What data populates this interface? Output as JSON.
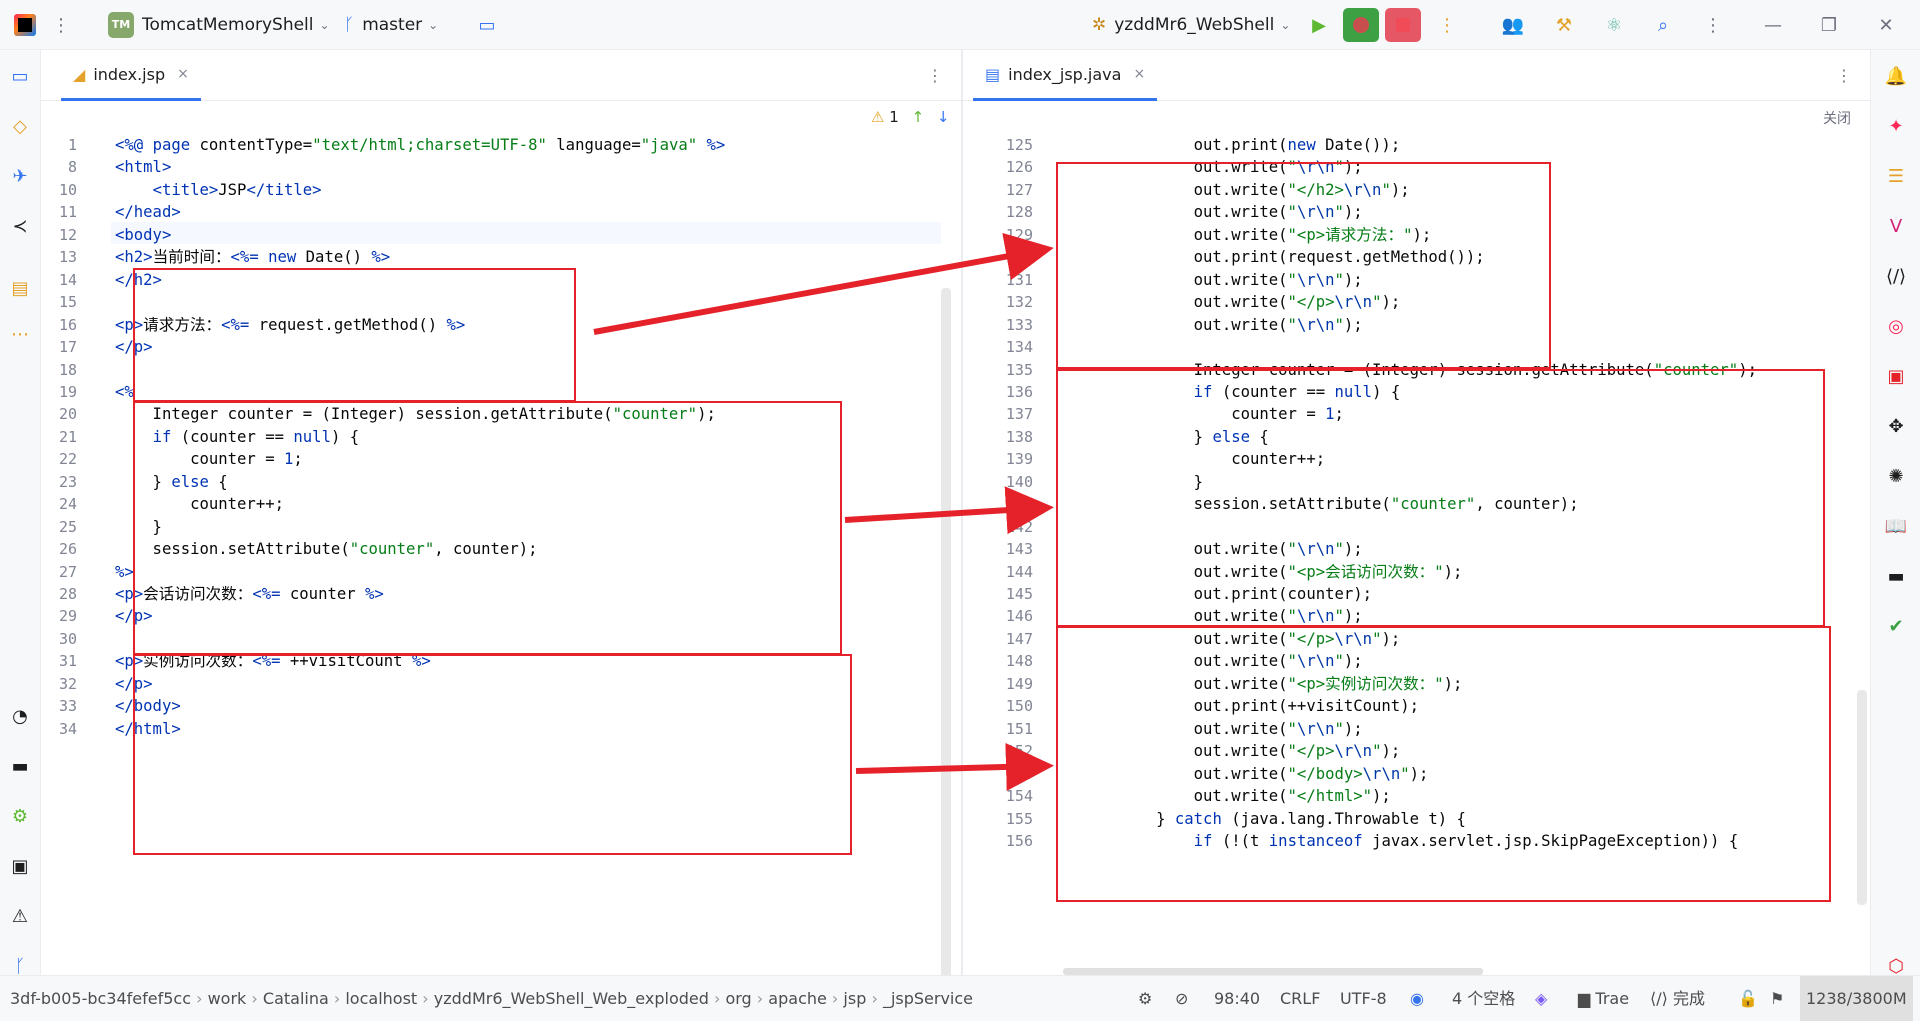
{
  "titlebar": {
    "project_badge": "TM",
    "project_name": "TomcatMemoryShell",
    "branch": "master",
    "run_config": "yzddMr6_WebShell"
  },
  "left_editor": {
    "tab_label": "index.jsp",
    "tab_close": "×",
    "warning_count": "1",
    "lines": [
      {
        "n": "1",
        "text": "<%@ page contentType=\"text/html;charset=UTF-8\" language=\"java\" %>"
      },
      {
        "n": "8",
        "text": "<html>"
      },
      {
        "n": "10",
        "text": "    <title>JSP</title>"
      },
      {
        "n": "11",
        "text": "</head>"
      },
      {
        "n": "12",
        "text": "<body>"
      },
      {
        "n": "13",
        "text": "<h2>当前时间：<%= new Date() %>"
      },
      {
        "n": "14",
        "text": "</h2>"
      },
      {
        "n": "15",
        "text": ""
      },
      {
        "n": "16",
        "text": "<p>请求方法：<%= request.getMethod() %>"
      },
      {
        "n": "17",
        "text": "</p>"
      },
      {
        "n": "18",
        "text": ""
      },
      {
        "n": "19",
        "text": "<%"
      },
      {
        "n": "20",
        "text": "    Integer counter = (Integer) session.getAttribute(\"counter\");"
      },
      {
        "n": "21",
        "text": "    if (counter == null) {"
      },
      {
        "n": "22",
        "text": "        counter = 1;"
      },
      {
        "n": "23",
        "text": "    } else {"
      },
      {
        "n": "24",
        "text": "        counter++;"
      },
      {
        "n": "25",
        "text": "    }"
      },
      {
        "n": "26",
        "text": "    session.setAttribute(\"counter\", counter);"
      },
      {
        "n": "27",
        "text": "%>"
      },
      {
        "n": "28",
        "text": "<p>会话访问次数：<%= counter %>"
      },
      {
        "n": "29",
        "text": "</p>"
      },
      {
        "n": "30",
        "text": ""
      },
      {
        "n": "31",
        "text": "<p>实例访问次数：<%= ++visitCount %>"
      },
      {
        "n": "32",
        "text": "</p>"
      },
      {
        "n": "33",
        "text": "</body>"
      },
      {
        "n": "34",
        "text": "</html>"
      }
    ]
  },
  "right_editor": {
    "tab_label": "index_jsp.java",
    "tab_close": "×",
    "close_hint": "关闭",
    "lines": [
      {
        "n": "125",
        "text": "            out.print(new Date());"
      },
      {
        "n": "126",
        "text": "            out.write(\"\\r\\n\");"
      },
      {
        "n": "127",
        "text": "            out.write(\"</h2>\\r\\n\");"
      },
      {
        "n": "128",
        "text": "            out.write(\"\\r\\n\");"
      },
      {
        "n": "129",
        "text": "            out.write(\"<p>请求方法：\");"
      },
      {
        "n": "130",
        "text": "            out.print(request.getMethod());"
      },
      {
        "n": "131",
        "text": "            out.write(\"\\r\\n\");"
      },
      {
        "n": "132",
        "text": "            out.write(\"</p>\\r\\n\");"
      },
      {
        "n": "133",
        "text": "            out.write(\"\\r\\n\");"
      },
      {
        "n": "134",
        "text": ""
      },
      {
        "n": "135",
        "text": "            Integer counter = (Integer) session.getAttribute(\"counter\");"
      },
      {
        "n": "136",
        "text": "            if (counter == null) {"
      },
      {
        "n": "137",
        "text": "                counter = 1;"
      },
      {
        "n": "138",
        "text": "            } else {"
      },
      {
        "n": "139",
        "text": "                counter++;"
      },
      {
        "n": "140",
        "text": "            }"
      },
      {
        "n": "141",
        "text": "            session.setAttribute(\"counter\", counter);"
      },
      {
        "n": "142",
        "text": ""
      },
      {
        "n": "143",
        "text": "            out.write(\"\\r\\n\");"
      },
      {
        "n": "144",
        "text": "            out.write(\"<p>会话访问次数：\");"
      },
      {
        "n": "145",
        "text": "            out.print(counter);"
      },
      {
        "n": "146",
        "text": "            out.write(\"\\r\\n\");"
      },
      {
        "n": "147",
        "text": "            out.write(\"</p>\\r\\n\");"
      },
      {
        "n": "148",
        "text": "            out.write(\"\\r\\n\");"
      },
      {
        "n": "149",
        "text": "            out.write(\"<p>实例访问次数：\");"
      },
      {
        "n": "150",
        "text": "            out.print(++visitCount);"
      },
      {
        "n": "151",
        "text": "            out.write(\"\\r\\n\");"
      },
      {
        "n": "152",
        "text": "            out.write(\"</p>\\r\\n\");"
      },
      {
        "n": "153",
        "text": "            out.write(\"</body>\\r\\n\");"
      },
      {
        "n": "154",
        "text": "            out.write(\"</html>\");"
      },
      {
        "n": "155",
        "text": "        } catch (java.lang.Throwable t) {"
      },
      {
        "n": "156",
        "text": "            if (!(t instanceof javax.servlet.jsp.SkipPageException)) {"
      }
    ]
  },
  "statusbar": {
    "breadcrumbs": [
      "3df-b005-bc34fefef5cc",
      "work",
      "Catalina",
      "localhost",
      "yzddMr6_WebShell_Web_exploded",
      "org",
      "apache",
      "jsp",
      "_jspService"
    ],
    "position": "98:40",
    "line_ending": "CRLF",
    "encoding": "UTF-8",
    "indent": "4 个空格",
    "trae": "Trae",
    "done": "完成",
    "memory": "1238/3800M"
  },
  "colors": {
    "annotation_red": "#e5222a",
    "accent_blue": "#3574f0"
  }
}
